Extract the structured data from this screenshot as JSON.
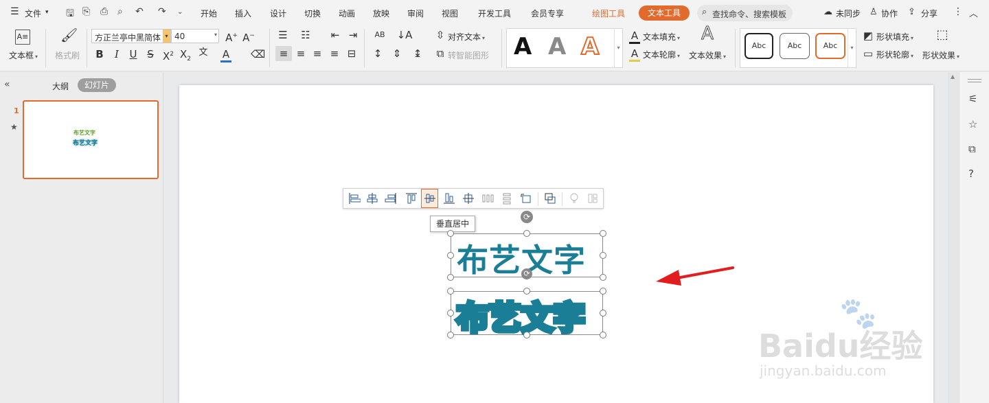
{
  "menubar": {
    "file_label": "文件",
    "tabs": [
      "开始",
      "插入",
      "设计",
      "切换",
      "动画",
      "放映",
      "审阅",
      "视图",
      "开发工具",
      "会员专享"
    ],
    "drawing_tools": "绘图工具",
    "text_tools": "文本工具",
    "search_placeholder": "查找命令、搜索模板",
    "sync": "未同步",
    "collab": "协作",
    "share": "分享"
  },
  "ribbon": {
    "textbox_label": "文本框",
    "format_brush_label": "格式刷",
    "font_name": "方正兰亭中黑简体",
    "font_size": "40",
    "align_text_label": "对齐文本",
    "smartart_label": "转智能图形",
    "style_sample_char": "A",
    "text_fill_label": "文本填充",
    "text_outline_label": "文本轮廓",
    "text_effect_label": "文本效果",
    "shape_samples": [
      "Abc",
      "Abc",
      "Abc"
    ],
    "shape_fill_label": "形状填充",
    "shape_outline_label": "形状轮廓",
    "shape_effect_label": "形状效果",
    "accent_color": "#e26a2c"
  },
  "left_panel": {
    "tab_outline": "大纲",
    "tab_slides": "幻灯片",
    "slide_number": "1",
    "thumb_line1": "布艺文字",
    "thumb_line2": "布艺文字"
  },
  "slide": {
    "text_top": "布艺文字",
    "text_bottom": "布艺文字",
    "text_color": "#1a7f96",
    "tooltip": "垂直居中"
  },
  "watermark": {
    "brand": "Baidu经验",
    "url": "jingyan.baidu.com"
  }
}
